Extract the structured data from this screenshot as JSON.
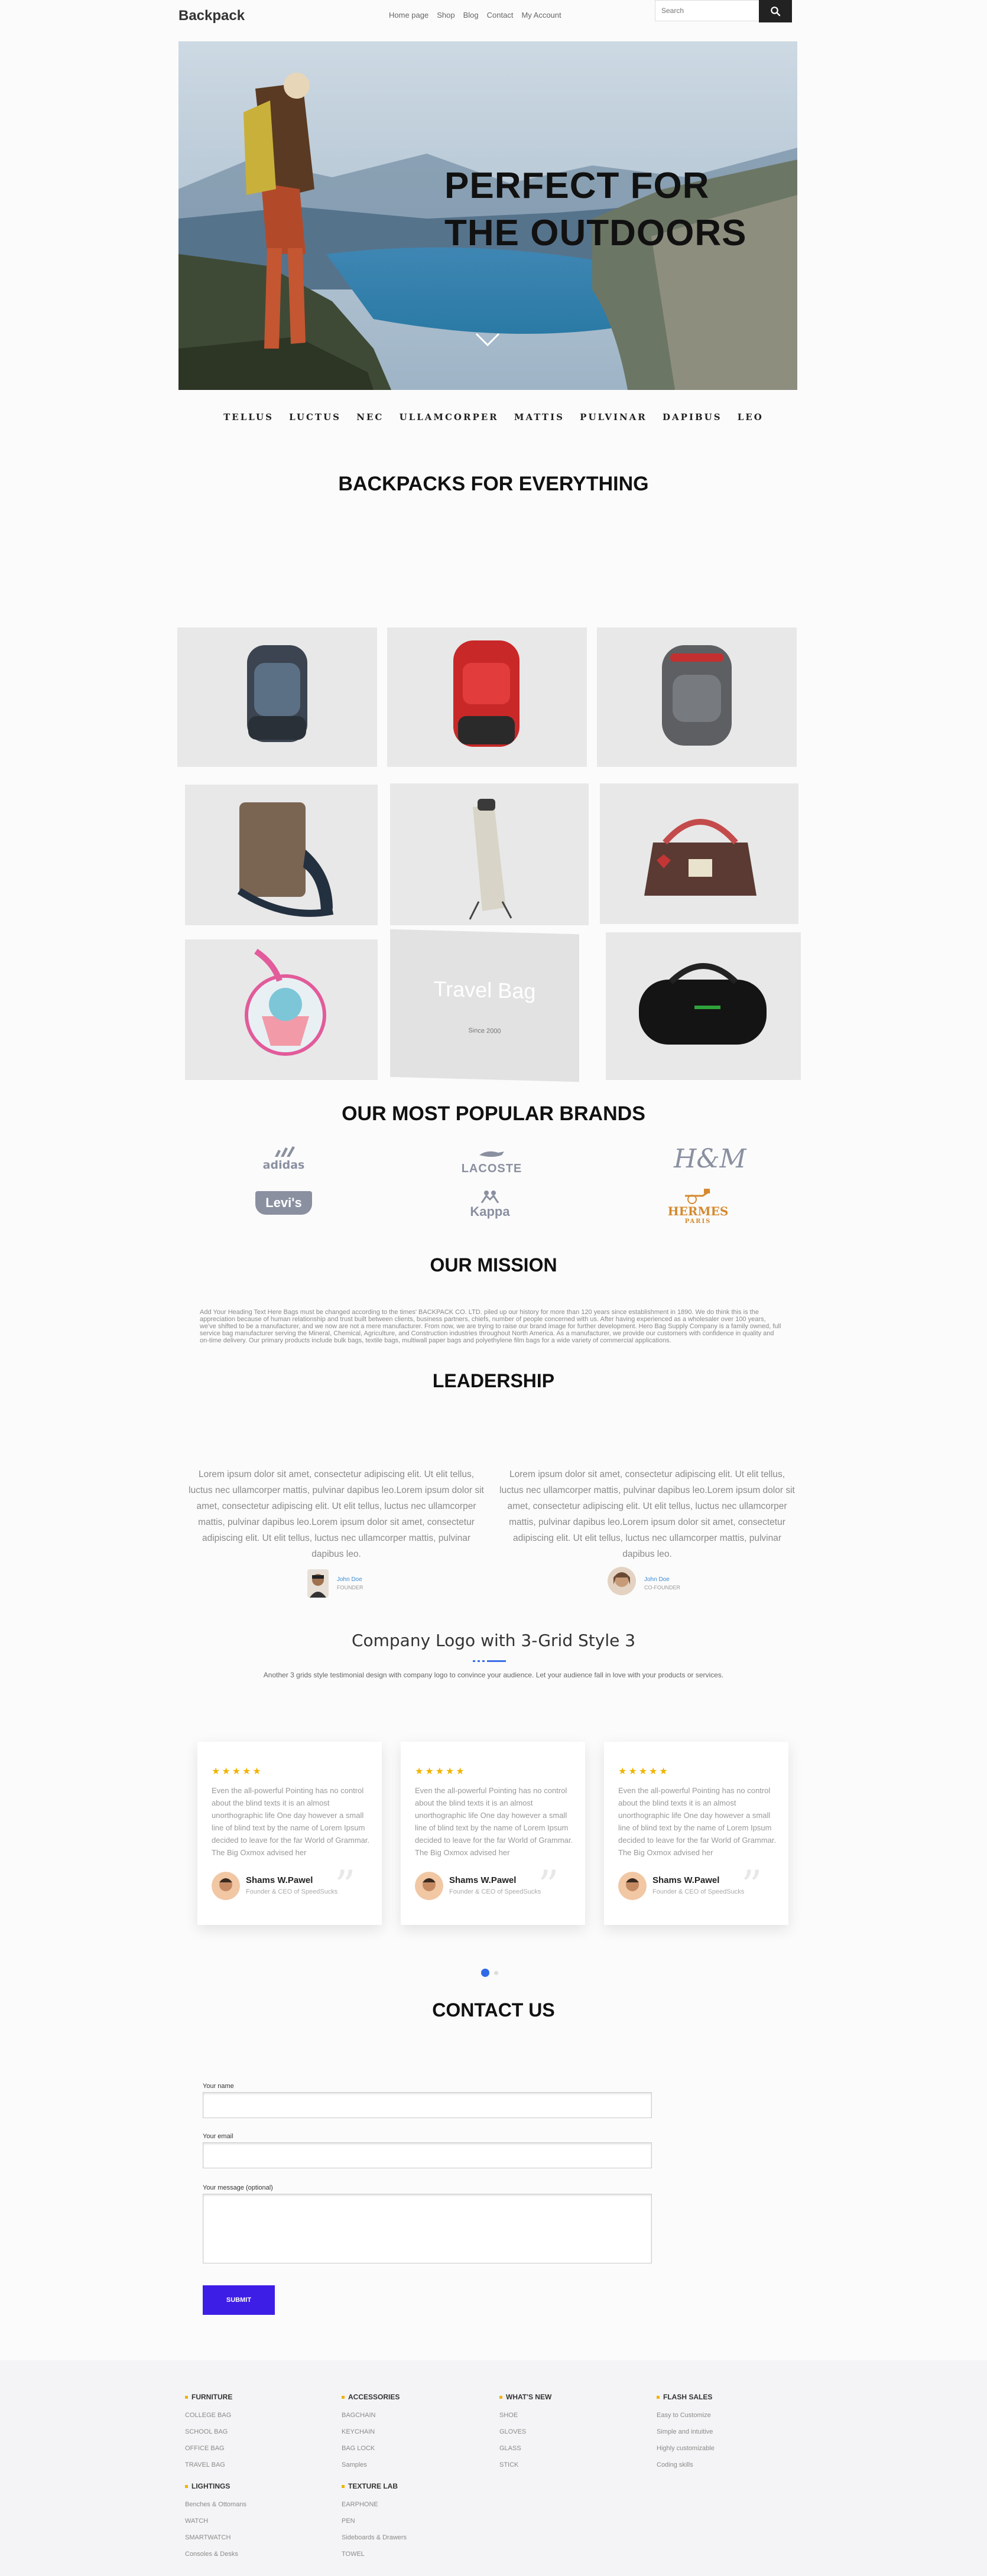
{
  "header": {
    "logo": "Backpack",
    "nav": [
      "Home page",
      "Shop",
      "Blog",
      "Contact",
      "My Account"
    ],
    "search_placeholder": "Search"
  },
  "hero": {
    "title_line1": "PERFECT FOR",
    "title_line2": "THE OUTDOORS"
  },
  "brand_strip": [
    "TELLUS",
    "LUCTUS",
    "NEC",
    "ULLAMCORPER",
    "MATTIS",
    "PULVINAR",
    "DAPIBUS",
    "LEO"
  ],
  "products": {
    "title": "BACKPACKS FOR EVERYTHING",
    "promo_title": "Travel Bag",
    "promo_subtitle": "Since 2000"
  },
  "brands": {
    "title": "OUR MOST POPULAR BRANDS",
    "logos": [
      "adidas",
      "LACOSTE",
      "H&M",
      "Levi's",
      "Kappa",
      "HERMES",
      "PARIS"
    ]
  },
  "mission": {
    "title": "OUR MISSION",
    "text": "Add Your Heading Text Here Bags must be changed according to the times' BACKPACK CO. LTD. piled up our history for more than 120 years since establishment in 1890. We do think this is the appreciation because of human relationship and trust built between clients, business partners, chiefs, number of people concerned with us. After having experienced as a wholesaler over 100 years, we've shifted to be a manufacturer, and we now are not a mere manufacturer. From now, we are trying to raise our brand image for further development. Hero Bag Supply Company is a family owned, full service bag manufacturer serving the Mineral, Chemical, Agriculture, and Construction industries throughout North America. As a manufacturer, we provide our customers with confidence in quality and on-time delivery. Our primary products include bulk bags, textile bags, multiwall paper bags and polyethylene film bags for a wide variety of commercial applications."
  },
  "leadership": {
    "title": "LEADERSHIP",
    "items": [
      {
        "text": "Lorem ipsum dolor sit amet, consectetur adipiscing elit. Ut elit tellus, luctus nec ullamcorper mattis, pulvinar dapibus leo.Lorem ipsum dolor sit amet, consectetur adipiscing elit. Ut elit tellus, luctus nec ullamcorper mattis, pulvinar dapibus leo.Lorem ipsum dolor sit amet, consectetur adipiscing elit. Ut elit tellus, luctus nec ullamcorper mattis, pulvinar dapibus leo.",
        "name": "John Doe",
        "role": "FOUNDER"
      },
      {
        "text": "Lorem ipsum dolor sit amet, consectetur adipiscing elit. Ut elit tellus, luctus nec ullamcorper mattis, pulvinar dapibus leo.Lorem ipsum dolor sit amet, consectetur adipiscing elit. Ut elit tellus, luctus nec ullamcorper mattis, pulvinar dapibus leo.Lorem ipsum dolor sit amet, consectetur adipiscing elit. Ut elit tellus, luctus nec ullamcorper mattis, pulvinar dapibus leo.",
        "name": "John Doe",
        "role": "CO-FOUNDER"
      }
    ]
  },
  "testimonials": {
    "title": "Company Logo with 3-Grid Style 3",
    "subtitle": "Another 3 grids style testimonial design with company logo to convince your audience. Let your audience fall in love with your products or services.",
    "stars": "★★★★★",
    "items": [
      {
        "text": "Even the all-powerful Pointing has no control about the blind texts it is an almost unorthographic life One day however a small line of blind text by the name of Lorem Ipsum decided to leave for the far World of Grammar. The Big Oxmox advised her",
        "name": "Shams W.Pawel",
        "role": "Founder & CEO of SpeedSucks"
      },
      {
        "text": "Even the all-powerful Pointing has no control about the blind texts it is an almost unorthographic life One day however a small line of blind text by the name of Lorem Ipsum decided to leave for the far World of Grammar. The Big Oxmox advised her",
        "name": "Shams W.Pawel",
        "role": "Founder & CEO of SpeedSucks"
      },
      {
        "text": "Even the all-powerful Pointing has no control about the blind texts it is an almost unorthographic life One day however a small line of blind text by the name of Lorem Ipsum decided to leave for the far World of Grammar. The Big Oxmox advised her",
        "name": "Shams W.Pawel",
        "role": "Founder & CEO of SpeedSucks"
      }
    ]
  },
  "contact": {
    "title": "CONTACT US",
    "name_label": "Your name",
    "email_label": "Your email",
    "message_label": "Your message (optional)",
    "submit_label": "SUBMIT"
  },
  "footer": {
    "columns": [
      {
        "heading": "FURNITURE",
        "links": [
          "COLLEGE BAG",
          "SCHOOL BAG",
          "OFFICE BAG",
          "TRAVEL BAG"
        ]
      },
      {
        "heading": "ACCESSORIES",
        "links": [
          "BAGCHAIN",
          "KEYCHAIN",
          "BAG LOCK",
          "Samples"
        ]
      },
      {
        "heading": "WHAT'S NEW",
        "links": [
          "SHOE",
          "GLOVES",
          "GLASS",
          "STICK"
        ]
      },
      {
        "heading": "FLASH SALES",
        "links": [
          "Easy to Customize",
          "Simple and intuitive",
          "Highly customizable",
          "Coding skills"
        ]
      },
      {
        "heading": "LIGHTINGS",
        "links": [
          "Benches & Ottomans",
          "WATCH",
          "SMARTWATCH",
          "Consoles & Desks"
        ]
      },
      {
        "heading": "TEXTURE LAB",
        "links": [
          "EARPHONE",
          "PEN",
          "Sideboards & Drawers",
          "TOWEL"
        ]
      }
    ]
  }
}
